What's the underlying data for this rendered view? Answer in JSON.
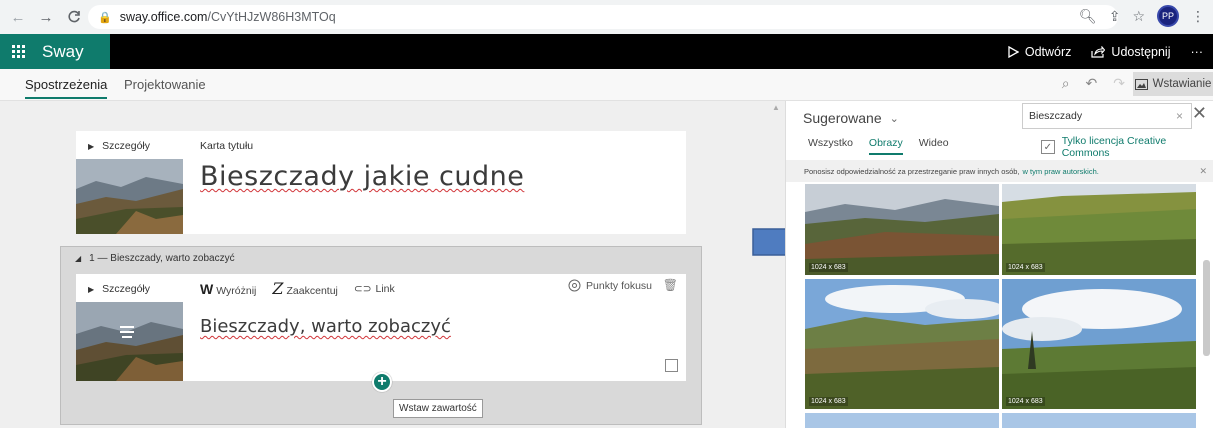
{
  "browser": {
    "url_host": "sway.office.com",
    "url_path": "/CvYtHJzW86H3MTOq",
    "avatar_initials": "PP"
  },
  "app": {
    "name": "Sway",
    "play_label": "Odtwórz",
    "share_label": "Udostępnij",
    "more_label": "···",
    "brand_color": "#0f7b6c"
  },
  "tabs": {
    "insights": "Spostrzeżenia",
    "design": "Projektowanie",
    "insert_label": "Wstawianie"
  },
  "title_card": {
    "details_label": "Szczegóły",
    "type_label": "Karta tytułu",
    "title": "Bieszczady jakie cudne"
  },
  "group": {
    "label": "1 — Bieszczady, warto zobaczyć",
    "card": {
      "details_label": "Szczegóły",
      "emphasize_label": "Wyróżnij",
      "accent_label": "Zaakcentuj",
      "link_label": "Link",
      "focus_label": "Punkty fokusu",
      "title": "Bieszczady, warto zobaczyć"
    }
  },
  "insert_tooltip": "Wstaw zawartość",
  "panel": {
    "heading": "Sugerowane",
    "search_value": "Bieszczady",
    "filters": [
      "Wszystko",
      "Obrazy",
      "Wideo"
    ],
    "active_filter": "Obrazy",
    "cc_label": "Tylko licencja Creative Commons",
    "notice_text": "Ponosisz odpowiedzialność za przestrzeganie praw innych osób,",
    "notice_link": "w tym praw autorskich.",
    "images": [
      {
        "size": "1024 x 683"
      },
      {
        "size": "1024 x 683"
      },
      {
        "size": "1024 x 683"
      },
      {
        "size": "1024 x 683"
      }
    ]
  }
}
